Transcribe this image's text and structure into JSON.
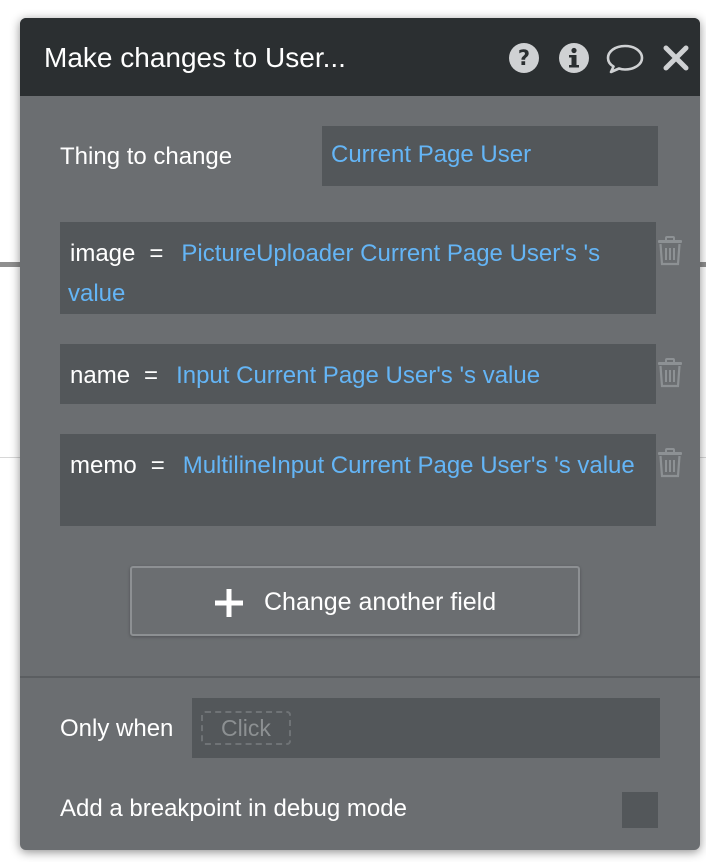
{
  "dialog": {
    "title": "Make changes to User...",
    "icons": [
      "help-icon",
      "info-icon",
      "comment-icon",
      "close-icon"
    ]
  },
  "thing": {
    "label": "Thing to change",
    "value": "Current Page User"
  },
  "fields": [
    {
      "name": "image",
      "operator": "=",
      "value": "PictureUploader Current Page User's 's value"
    },
    {
      "name": "name",
      "operator": "=",
      "value": "Input Current Page User's 's value"
    },
    {
      "name": "memo",
      "operator": "=",
      "value": "MultilineInput Current Page User's 's value"
    }
  ],
  "change_button": {
    "label": "Change another field",
    "icon": "plus-icon"
  },
  "only_when": {
    "label": "Only when",
    "placeholder": "Click"
  },
  "breakpoint": {
    "label": "Add a breakpoint in debug mode",
    "checked": false
  },
  "colors": {
    "titlebar": "#2b2f31",
    "panel": "#6b6e71",
    "input_bg": "#53575a",
    "dynamic_text": "#64b5f6",
    "text": "#ffffff"
  }
}
